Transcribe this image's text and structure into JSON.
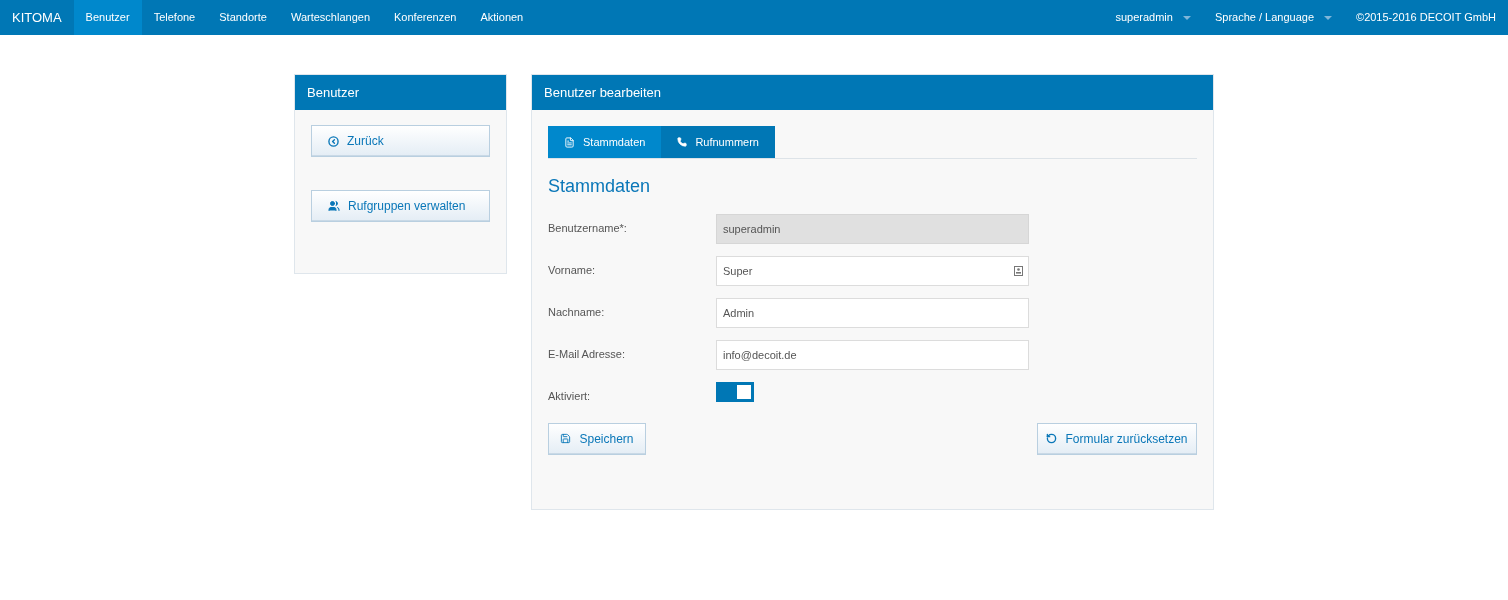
{
  "navbar": {
    "brand": "KITOMA",
    "items": [
      {
        "label": "Benutzer",
        "selected": true
      },
      {
        "label": "Telefone",
        "selected": false
      },
      {
        "label": "Standorte",
        "selected": false
      },
      {
        "label": "Warteschlangen",
        "selected": false
      },
      {
        "label": "Konferenzen",
        "selected": false
      },
      {
        "label": "Aktionen",
        "selected": false
      }
    ],
    "right": [
      {
        "kind": "dropdown",
        "label": "superadmin"
      },
      {
        "kind": "dropdown",
        "label": "Sprache / Language"
      },
      {
        "kind": "text",
        "label": "©2015-2016 DECOIT GmbH"
      }
    ]
  },
  "sidebar": {
    "title": "Benutzer",
    "buttons": [
      {
        "kind": "back",
        "label": "Zurück"
      },
      {
        "kind": "groups",
        "label": "Rufgruppen verwalten"
      }
    ]
  },
  "editor": {
    "title": "Benutzer bearbeiten",
    "tabs": [
      {
        "kind": "document",
        "label": "Stammdaten",
        "selected": true
      },
      {
        "kind": "phone",
        "label": "Rufnummern",
        "selected": false
      }
    ],
    "heading": "Stammdaten",
    "fields": [
      {
        "kind": "text",
        "label": "Benutzername*:",
        "value": "superadmin",
        "disabled": true,
        "autofill_icon": false
      },
      {
        "kind": "text",
        "label": "Vorname:",
        "value": "Super",
        "disabled": false,
        "autofill_icon": true
      },
      {
        "kind": "text",
        "label": "Nachname:",
        "value": "Admin",
        "disabled": false,
        "autofill_icon": false
      },
      {
        "kind": "text",
        "label": "E-Mail Adresse:",
        "value": "info@decoit.de",
        "disabled": false,
        "autofill_icon": false
      },
      {
        "kind": "toggle",
        "label": "Aktiviert:",
        "on": true
      }
    ],
    "save_button": "Speichern",
    "reset_button": "Formular zurücksetzen"
  }
}
